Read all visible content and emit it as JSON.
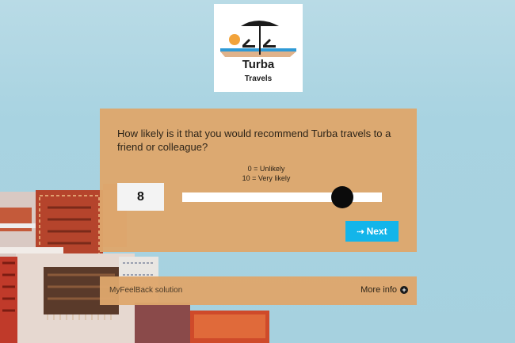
{
  "logo": {
    "title": "Turba",
    "subtitle": "Travels"
  },
  "survey": {
    "question": "How likely is it that you would recommend Turba travels to a friend or colleague?",
    "scale_min_label": "0 = Unlikely",
    "scale_max_label": "10 = Very likely",
    "value": "8",
    "slider": {
      "min": 0,
      "max": 10,
      "value": 8
    },
    "next_label": "Next",
    "next_icon": "arrow-right-icon"
  },
  "footer": {
    "powered_by": "MyFeelBack solution",
    "more_info_label": "More info",
    "more_info_icon": "plus-circle-icon"
  },
  "colors": {
    "card": "#dea76c",
    "button": "#13b5ea",
    "sky": "#a8d3e1"
  }
}
